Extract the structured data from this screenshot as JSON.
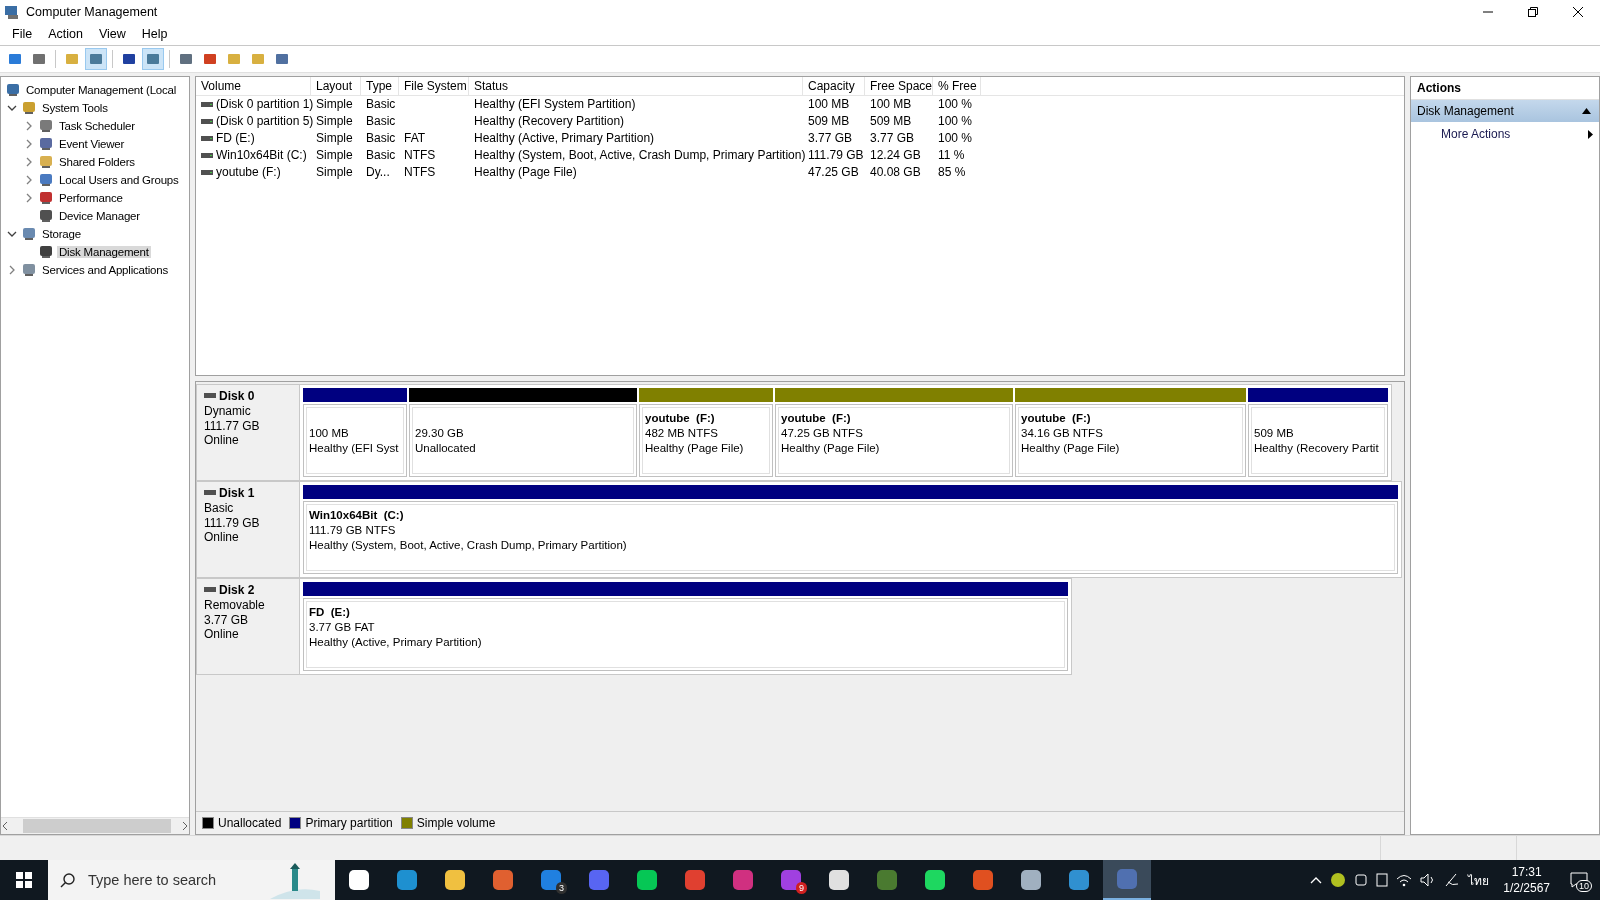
{
  "window": {
    "title": "Computer Management"
  },
  "menu": [
    "File",
    "Action",
    "View",
    "Help"
  ],
  "toolbar": [
    {
      "pressed": false
    },
    {
      "pressed": false
    },
    {
      "pressed": false
    },
    {
      "pressed": true
    },
    {
      "pressed": false
    },
    {
      "pressed": true
    },
    {
      "pressed": false
    },
    {
      "pressed": false
    },
    {
      "pressed": false
    },
    {
      "pressed": false
    },
    {
      "pressed": false
    }
  ],
  "tree": [
    {
      "label": "Computer Management (Local",
      "selected": false,
      "children": [
        {
          "label": "System Tools",
          "expanded": true,
          "selected": false,
          "children": [
            {
              "label": "Task Scheduler",
              "expanded": false,
              "selected": false
            },
            {
              "label": "Event Viewer",
              "expanded": false,
              "selected": false
            },
            {
              "label": "Shared Folders",
              "expanded": false,
              "selected": false
            },
            {
              "label": "Local Users and Groups",
              "expanded": false,
              "selected": false
            },
            {
              "label": "Performance",
              "expanded": false,
              "selected": false
            },
            {
              "label": "Device Manager",
              "selected": false
            }
          ]
        },
        {
          "label": "Storage",
          "expanded": true,
          "selected": false,
          "children": [
            {
              "label": "Disk Management",
              "selected": true
            }
          ]
        },
        {
          "label": "Services and Applications",
          "expanded": false,
          "selected": false
        }
      ]
    }
  ],
  "table": {
    "columns": [
      "Volume",
      "Layout",
      "Type",
      "File System",
      "Status",
      "Capacity",
      "Free Space",
      "% Free"
    ],
    "rows": [
      [
        "(Disk 0 partition 1)",
        "Simple",
        "Basic",
        "",
        "Healthy (EFI System Partition)",
        "100 MB",
        "100 MB",
        "100 %"
      ],
      [
        "(Disk 0 partition 5)",
        "Simple",
        "Basic",
        "",
        "Healthy (Recovery Partition)",
        "509 MB",
        "509 MB",
        "100 %"
      ],
      [
        "FD (E:)",
        "Simple",
        "Basic",
        "FAT",
        "Healthy (Active, Primary Partition)",
        "3.77 GB",
        "3.77 GB",
        "100 %"
      ],
      [
        "Win10x64Bit (C:)",
        "Simple",
        "Basic",
        "NTFS",
        "Healthy (System, Boot, Active, Crash Dump, Primary Partition)",
        "111.79 GB",
        "12.24 GB",
        "11 %"
      ],
      [
        "youtube (F:)",
        "Simple",
        "Dy...",
        "NTFS",
        "Healthy (Page File)",
        "47.25 GB",
        "40.08 GB",
        "85 %"
      ]
    ]
  },
  "disks": [
    {
      "name": "Disk 0",
      "type": "Dynamic",
      "size": "111.77 GB",
      "status": "Online",
      "partitions": [
        {
          "kind": "primary",
          "lines": [
            "100 MB",
            "Healthy (EFI Syst"
          ]
        },
        {
          "kind": "unallocated",
          "lines": [
            "29.30 GB",
            "Unallocated"
          ]
        },
        {
          "kind": "simple",
          "title": "youtube  (F:)",
          "lines": [
            "482 MB NTFS",
            "Healthy (Page File)"
          ]
        },
        {
          "kind": "simple",
          "title": "youtube  (F:)",
          "lines": [
            "47.25 GB NTFS",
            "Healthy (Page File)"
          ]
        },
        {
          "kind": "simple",
          "title": "youtube  (F:)",
          "lines": [
            "34.16 GB NTFS",
            "Healthy (Page File)"
          ]
        },
        {
          "kind": "primary",
          "lines": [
            "509 MB",
            "Healthy (Recovery Partit"
          ]
        }
      ]
    },
    {
      "name": "Disk 1",
      "type": "Basic",
      "size": "111.79 GB",
      "status": "Online",
      "partitions": [
        {
          "kind": "primary",
          "title": "Win10x64Bit  (C:)",
          "lines": [
            "111.79 GB NTFS",
            "Healthy (System, Boot, Active, Crash Dump, Primary Partition)"
          ]
        }
      ]
    },
    {
      "name": "Disk 2",
      "type": "Removable",
      "size": "3.77 GB",
      "status": "Online",
      "partitions": [
        {
          "kind": "primary",
          "title": "FD  (E:)",
          "lines": [
            "3.77 GB FAT",
            "Healthy (Active, Primary Partition)"
          ]
        }
      ]
    }
  ],
  "legend": [
    {
      "label": "Unallocated",
      "color": "#000000"
    },
    {
      "label": "Primary partition",
      "color": "#000080"
    },
    {
      "label": "Simple volume",
      "color": "#808000"
    }
  ],
  "actions": {
    "title": "Actions",
    "section": "Disk Management",
    "items": [
      "More Actions"
    ]
  },
  "taskbar": {
    "search": {
      "placeholder": "Type here to search"
    },
    "apps": [
      {
        "selected": false
      },
      {
        "selected": false
      },
      {
        "selected": false
      },
      {
        "selected": false
      },
      {
        "badge": "3",
        "selected": false
      },
      {
        "selected": false
      },
      {
        "selected": false
      },
      {
        "selected": false
      },
      {
        "selected": false
      },
      {
        "badge": "9",
        "selected": false
      },
      {
        "selected": false
      },
      {
        "selected": false
      },
      {
        "selected": false
      },
      {
        "selected": false
      },
      {
        "selected": false
      },
      {
        "selected": false
      },
      {
        "selected": true
      }
    ],
    "language": "ไทย",
    "time": "17:31",
    "date": "1/2/2567",
    "notifications": "10"
  }
}
